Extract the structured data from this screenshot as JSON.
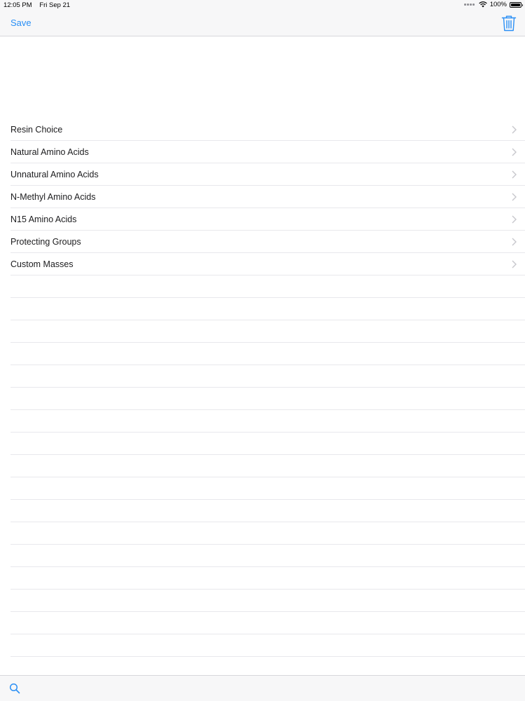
{
  "status_bar": {
    "time": "12:05 PM",
    "date": "Fri Sep 21",
    "battery": "100%",
    "battery_level": 1.0,
    "wifi_icon": "wifi-icon",
    "signal_icon": "signal-dots-icon"
  },
  "nav": {
    "save_label": "Save",
    "trash_icon": "trash-icon"
  },
  "menu": {
    "items": [
      {
        "label": "Resin Choice"
      },
      {
        "label": "Natural Amino Acids"
      },
      {
        "label": "Unnatural Amino Acids"
      },
      {
        "label": "N-Methyl Amino Acids"
      },
      {
        "label": "N15 Amino Acids"
      },
      {
        "label": "Protecting Groups"
      },
      {
        "label": "Custom Masses"
      }
    ]
  },
  "toolbar": {
    "search_icon": "search-icon"
  },
  "colors": {
    "accent": "#2a8ff5",
    "bar_background": "#f7f7f8",
    "separator": "#e8e8ec",
    "chevron": "#c7c7cc"
  }
}
